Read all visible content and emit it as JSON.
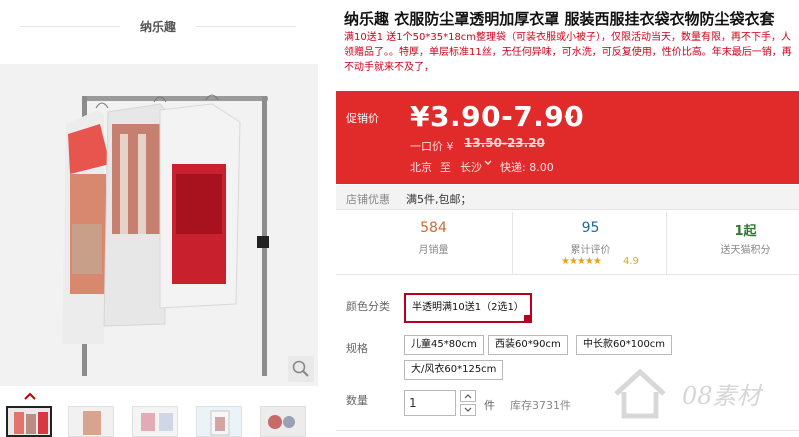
{
  "shop": {
    "name": "纳乐趣"
  },
  "gallery": {
    "thumb_up_arrow": "chevron-up-icon",
    "zoom_icon": "magnifier-icon",
    "thumbnails": [
      {
        "name": "thumb-1",
        "active": true
      },
      {
        "name": "thumb-2",
        "active": false
      },
      {
        "name": "thumb-3",
        "active": false
      },
      {
        "name": "thumb-4",
        "active": false
      },
      {
        "name": "thumb-5",
        "active": false
      }
    ]
  },
  "product": {
    "title": "纳乐趣 衣服防尘罩透明加厚衣罩 服装西服挂衣袋衣物防尘袋衣套",
    "subtitle": "满10送1 送1个50*35*18cm整理袋（可装衣服或小被子），仅限活动当天，数量有限，再不下手，人领赠品了。。特厚，单层标准11丝，无任何异味，可水洗，可反复使用，性价比高。年末最后一销，再不动手就来不及了，"
  },
  "price": {
    "label": "促销价",
    "current": "¥3.90-7.90",
    "original_label": "一口价 ¥",
    "original": "13.50-23.20",
    "ship_from": "北京",
    "ship_sep": "至",
    "ship_to": "长沙",
    "ship_fee": "快递: 8.00"
  },
  "promo": {
    "label": "店铺优惠",
    "value": "满5件,包邮；"
  },
  "stats": {
    "monthly_sales": "584",
    "monthly_sales_label": "月销量",
    "reviews": "95",
    "reviews_label": "累计评价",
    "stars": "★★★★★",
    "rating": "4.9",
    "points": "1起",
    "points_label": "送天猫积分"
  },
  "options": {
    "color_label": "颜色分类",
    "colors": [
      "半透明满10送1（2选1）"
    ],
    "selected_color": 0,
    "size_label": "规格",
    "sizes": [
      "儿童45*80cm",
      "西装60*90cm",
      "中长款60*100cm",
      "大/风衣60*125cm"
    ]
  },
  "quantity": {
    "label": "数量",
    "value": "1",
    "unit": "件",
    "stock": "库存3731件"
  },
  "watermark": {
    "text": "08素材"
  },
  "colors": {
    "price_bg": "#e12a2a",
    "selected_border": "#b8001e",
    "rating": "#e8a21b"
  }
}
